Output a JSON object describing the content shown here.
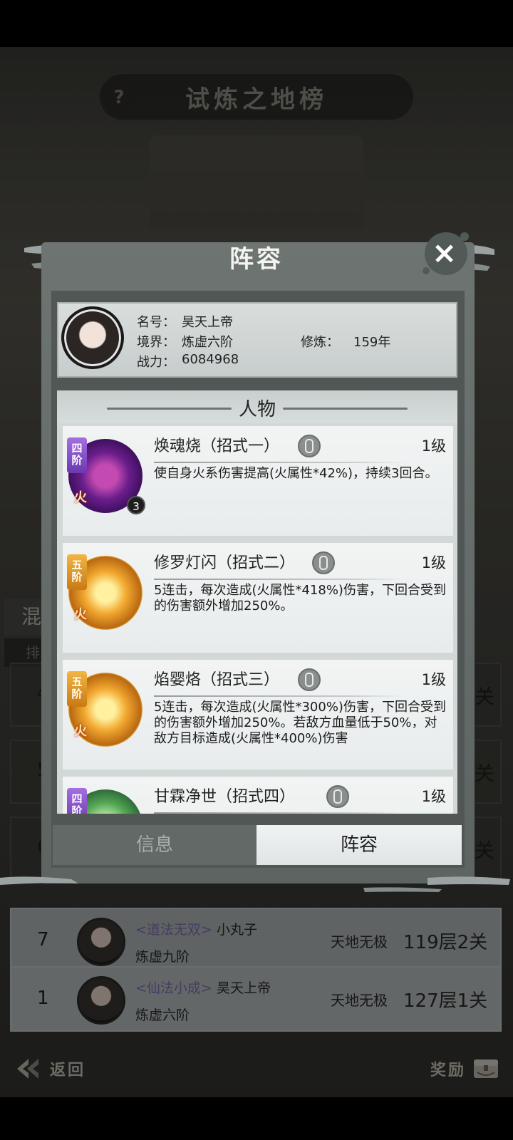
{
  "background": {
    "title": "试炼之地榜",
    "help_icon": "?",
    "tab_label": "混",
    "tab2_label": "排",
    "rows": [
      {
        "num": "4",
        "partial": "关"
      },
      {
        "num": "5",
        "partial": "关"
      },
      {
        "num": "6",
        "partial": "关"
      }
    ],
    "ranks": [
      {
        "num": "7",
        "title": "<道法无双>",
        "name": "小丸子",
        "realm": "炼虚九阶",
        "tier": "天地无极",
        "floor": "119层2关"
      },
      {
        "num": "1",
        "title": "<仙法小成>",
        "name": "昊天上帝",
        "realm": "炼虚六阶",
        "tier": "天地无极",
        "floor": "127层1关"
      }
    ],
    "back_label": "返回",
    "reward_label": "奖励"
  },
  "dialog": {
    "title": "阵容",
    "close_icon": "×",
    "player": {
      "name_label": "名号：",
      "name": "昊天上帝",
      "realm_label": "境界：",
      "realm": "炼虚六阶",
      "cultivation_label": "修炼：",
      "cultivation": "159年",
      "power_label": "战力：",
      "power": "6084968"
    },
    "section_title": "人物",
    "skills": [
      {
        "grade": "四阶",
        "element": "火",
        "stack": "3",
        "name": "焕魂烧（招式一）",
        "level": "1级",
        "desc": "使自身火系伤害提高(火属性*42%)，持续3回合。"
      },
      {
        "grade": "五阶",
        "element": "火",
        "name": "修罗灯闪（招式二）",
        "level": "1级",
        "desc": "5连击，每次造成(火属性*418%)伤害，下回合受到的伤害额外增加250%。"
      },
      {
        "grade": "五阶",
        "element": "火",
        "name": "焰婴烙（招式三）",
        "level": "1级",
        "desc": "5连击，每次造成(火属性*300%)伤害，下回合受到的伤害额外增加250%。若敌方血量低于50%，对敌方目标造成(火属性*400%)伤害"
      },
      {
        "grade": "四阶",
        "name": "甘霖净世（招式四）",
        "level": "1级",
        "desc": ""
      }
    ],
    "tabs": {
      "info": "信息",
      "lineup": "阵容"
    }
  }
}
